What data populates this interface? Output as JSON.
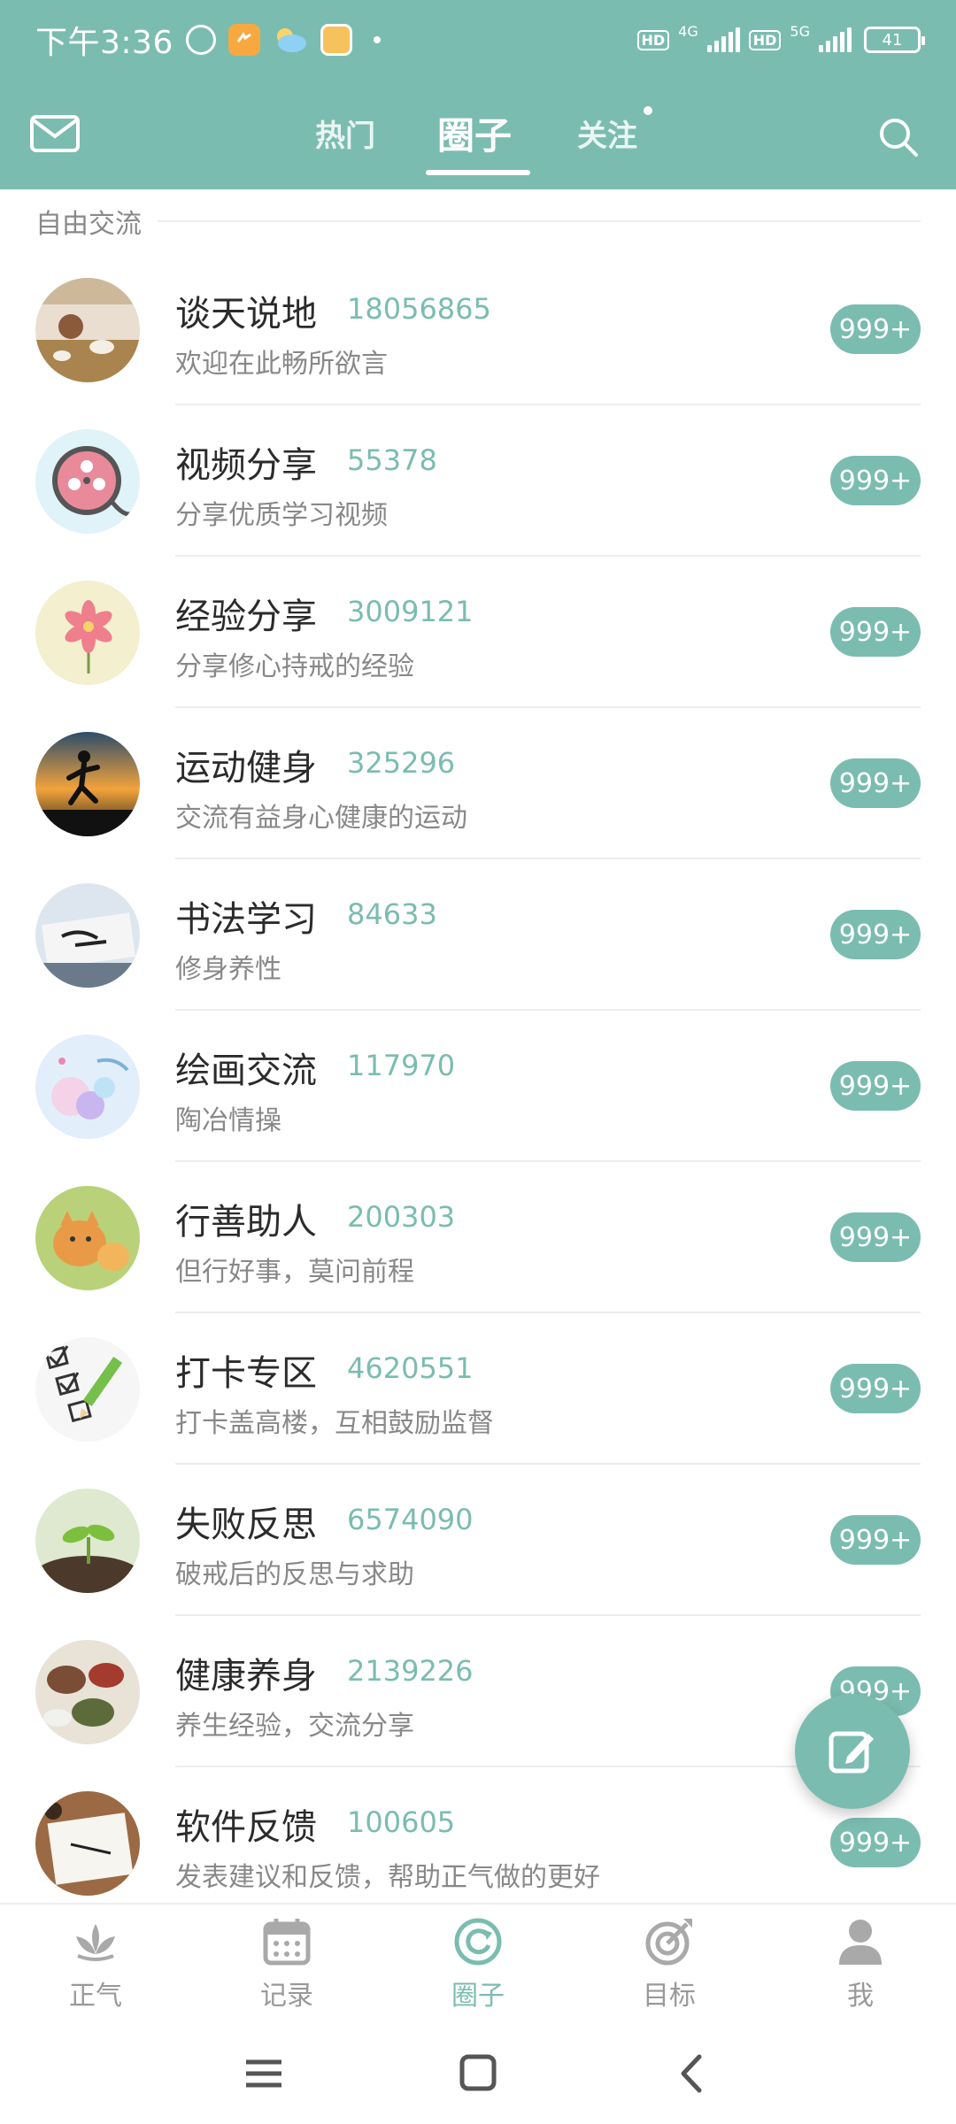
{
  "status": {
    "time": "下午3:36",
    "hd1": "HD",
    "net1": "4G",
    "hd2": "HD",
    "net2": "5G",
    "battery": "41"
  },
  "nav": {
    "tabs": [
      "热门",
      "圈子",
      "关注"
    ],
    "active_tab": "圈子"
  },
  "section": {
    "label": "自由交流"
  },
  "circles": [
    {
      "title": "谈天说地",
      "count": "18056865",
      "subtitle": "欢迎在此畅所欲言",
      "badge": "999+"
    },
    {
      "title": "视频分享",
      "count": "55378",
      "subtitle": "分享优质学习视频",
      "badge": "999+"
    },
    {
      "title": "经验分享",
      "count": "3009121",
      "subtitle": "分享修心持戒的经验",
      "badge": "999+"
    },
    {
      "title": "运动健身",
      "count": "325296",
      "subtitle": "交流有益身心健康的运动",
      "badge": "999+"
    },
    {
      "title": "书法学习",
      "count": "84633",
      "subtitle": "修身养性",
      "badge": "999+"
    },
    {
      "title": "绘画交流",
      "count": "117970",
      "subtitle": "陶冶情操",
      "badge": "999+"
    },
    {
      "title": "行善助人",
      "count": "200303",
      "subtitle": "但行好事，莫问前程",
      "badge": "999+"
    },
    {
      "title": "打卡专区",
      "count": "4620551",
      "subtitle": "打卡盖高楼，互相鼓励监督",
      "badge": "999+"
    },
    {
      "title": "失败反思",
      "count": "6574090",
      "subtitle": "破戒后的反思与求助",
      "badge": "999+"
    },
    {
      "title": "健康养身",
      "count": "2139226",
      "subtitle": "养生经验，交流分享",
      "badge": "999+"
    },
    {
      "title": "软件反馈",
      "count": "100605",
      "subtitle": "发表建议和反馈，帮助正气做的更好",
      "badge": "999+"
    }
  ],
  "bottom_nav": [
    {
      "label": "正气",
      "icon": "lotus-icon"
    },
    {
      "label": "记录",
      "icon": "calendar-icon"
    },
    {
      "label": "圈子",
      "icon": "circle-refresh-icon"
    },
    {
      "label": "目标",
      "icon": "target-icon"
    },
    {
      "label": "我",
      "icon": "person-icon"
    }
  ],
  "bottom_nav_active": "圈子",
  "colors": {
    "accent": "#7bbcb0",
    "count_text": "#7bbcb0",
    "badge_bg": "#7bbcb0"
  }
}
